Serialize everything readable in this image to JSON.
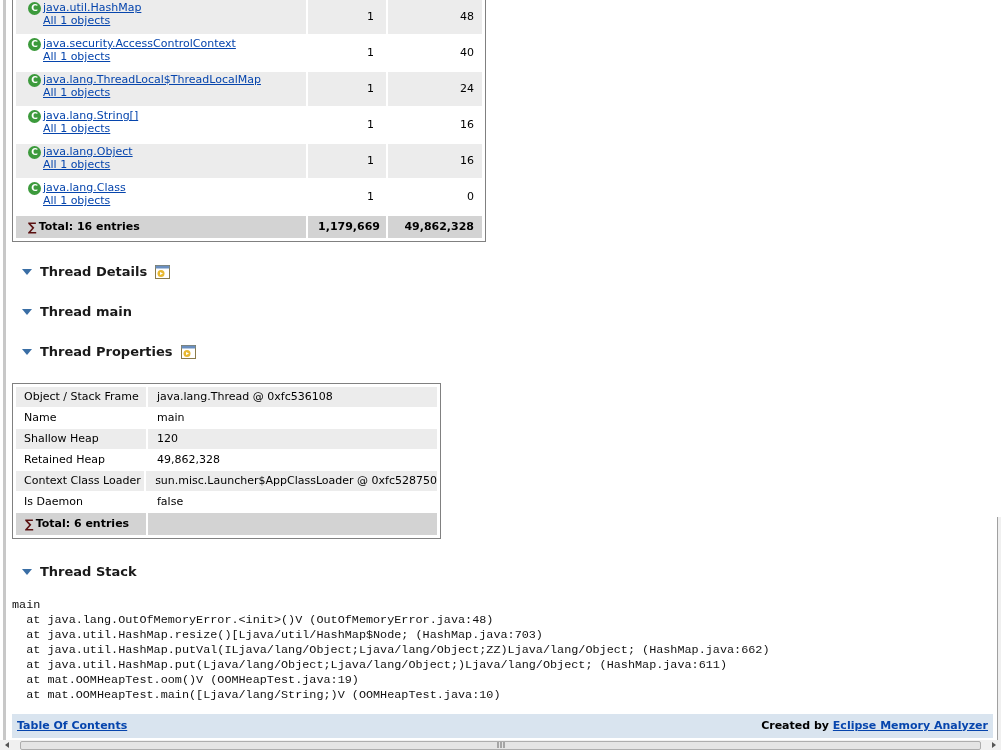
{
  "class_table": {
    "rows": [
      {
        "badge": "C",
        "class_name": "java.util.HashMap",
        "objects_link": "All 1 objects",
        "objects": "1",
        "heap": "48"
      },
      {
        "badge": "C",
        "class_name": "java.security.AccessControlContext",
        "objects_link": "All 1 objects",
        "objects": "1",
        "heap": "40"
      },
      {
        "badge": "C",
        "class_name": "java.lang.ThreadLocal$ThreadLocalMap",
        "objects_link": "All 1 objects",
        "objects": "1",
        "heap": "24"
      },
      {
        "badge": "C",
        "class_name": "java.lang.String[]",
        "objects_link": "All 1 objects",
        "objects": "1",
        "heap": "16"
      },
      {
        "badge": "C",
        "class_name": "java.lang.Object",
        "objects_link": "All 1 objects",
        "objects": "1",
        "heap": "16"
      },
      {
        "badge": "C",
        "class_name": "java.lang.Class",
        "objects_link": "All 1 objects",
        "objects": "1",
        "heap": "0"
      }
    ],
    "total": {
      "symbol": "∑",
      "label": "Total: 16 entries",
      "objects": "1,179,669",
      "heap": "49,862,328"
    }
  },
  "sections": [
    {
      "title": "Thread Details",
      "expanded": true,
      "has_details_icon": true
    },
    {
      "title": "Thread main",
      "expanded": true,
      "has_details_icon": false
    },
    {
      "title": "Thread Properties",
      "expanded": true,
      "has_details_icon": true
    }
  ],
  "properties_table": {
    "rows": [
      {
        "key": "Object / Stack Frame",
        "value": "java.lang.Thread @ 0xfc536108"
      },
      {
        "key": "Name",
        "value": "main"
      },
      {
        "key": "Shallow Heap",
        "value": "120"
      },
      {
        "key": "Retained Heap",
        "value": "49,862,328"
      },
      {
        "key": "Context Class Loader",
        "value": "sun.misc.Launcher$AppClassLoader @ 0xfc528750"
      },
      {
        "key": "Is Daemon",
        "value": "false"
      }
    ],
    "total": {
      "symbol": "∑",
      "label": "Total: 6 entries"
    }
  },
  "stack_section": {
    "title": "Thread Stack",
    "expanded": true
  },
  "thread_stack": [
    "main",
    "  at java.lang.OutOfMemoryError.<init>()V (OutOfMemoryError.java:48)",
    "  at java.util.HashMap.resize()[Ljava/util/HashMap$Node; (HashMap.java:703)",
    "  at java.util.HashMap.putVal(ILjava/lang/Object;Ljava/lang/Object;ZZ)Ljava/lang/Object; (HashMap.java:662)",
    "  at java.util.HashMap.put(Ljava/lang/Object;Ljava/lang/Object;)Ljava/lang/Object; (HashMap.java:611)",
    "  at mat.OOMHeapTest.oom()V (OOMHeapTest.java:19)",
    "  at mat.OOMHeapTest.main([Ljava/lang/String;)V (OOMHeapTest.java:10)"
  ],
  "footer": {
    "toc_link": "Table Of Contents",
    "created_by": "Created by",
    "tool_link": "Eclipse Memory Analyzer"
  }
}
